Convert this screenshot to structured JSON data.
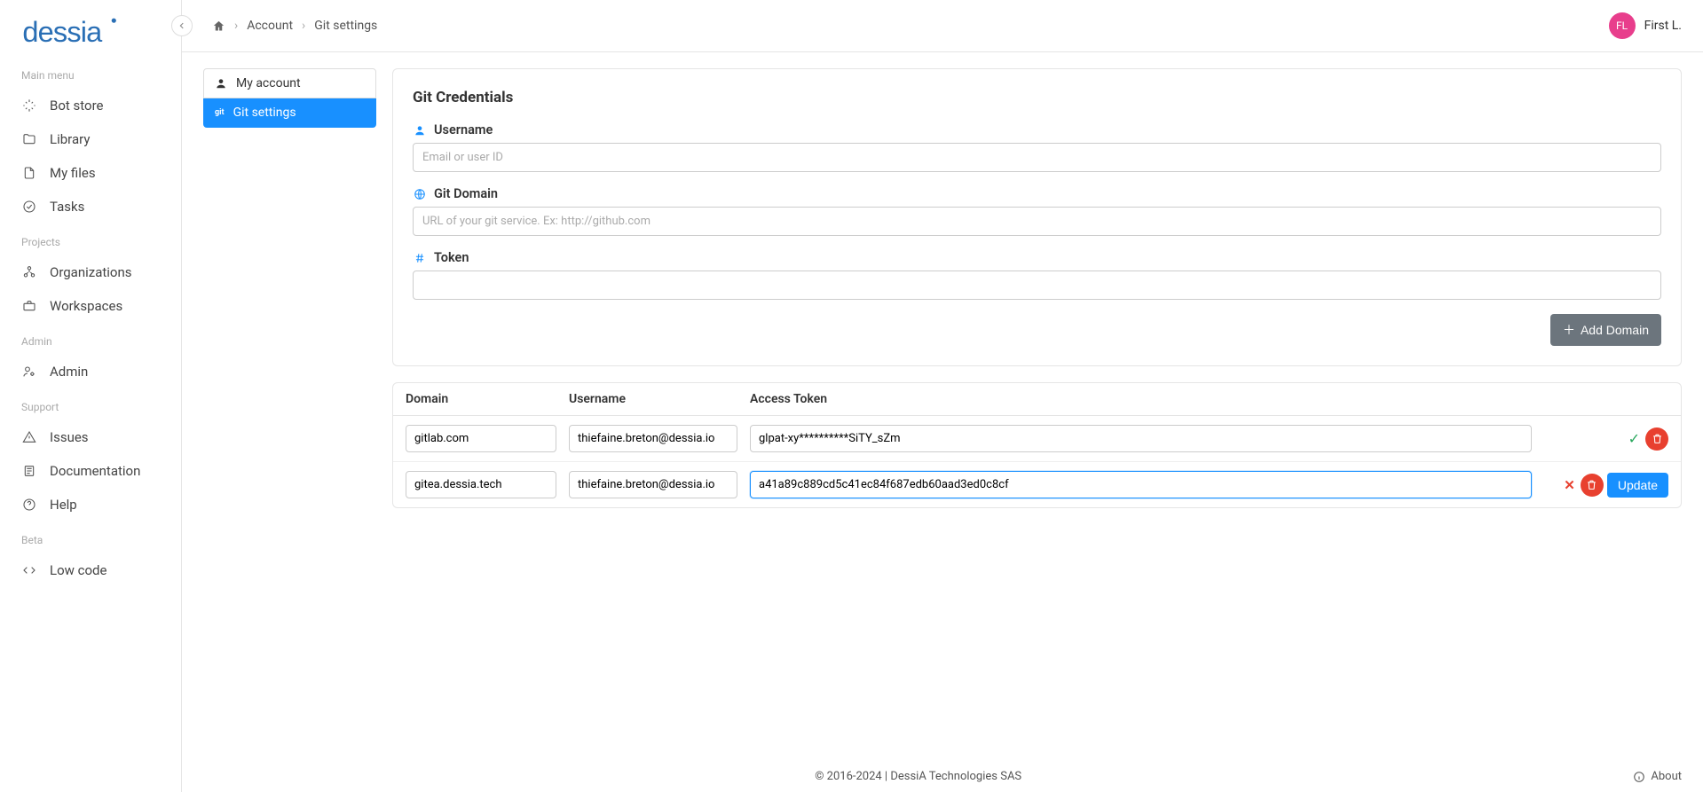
{
  "brand": "dessia",
  "breadcrumb": {
    "account": "Account",
    "git": "Git settings"
  },
  "user": {
    "initials": "FL",
    "name": "First L."
  },
  "sidebar": {
    "groups": [
      {
        "label": "Main menu",
        "items": [
          {
            "label": "Bot store"
          },
          {
            "label": "Library"
          },
          {
            "label": "My files"
          },
          {
            "label": "Tasks"
          }
        ]
      },
      {
        "label": "Projects",
        "items": [
          {
            "label": "Organizations"
          },
          {
            "label": "Workspaces"
          }
        ]
      },
      {
        "label": "Admin",
        "items": [
          {
            "label": "Admin"
          }
        ]
      },
      {
        "label": "Support",
        "items": [
          {
            "label": "Issues"
          },
          {
            "label": "Documentation"
          },
          {
            "label": "Help"
          }
        ]
      },
      {
        "label": "Beta",
        "items": [
          {
            "label": "Low code"
          }
        ]
      }
    ]
  },
  "subnav": {
    "my_account": "My account",
    "git_settings": "Git settings",
    "git_prefix": "git"
  },
  "form": {
    "title": "Git Credentials",
    "username_label": "Username",
    "username_ph": "Email or user ID",
    "domain_label": "Git Domain",
    "domain_ph": "URL of your git service. Ex: http://github.com",
    "token_label": "Token",
    "add_btn": "Add Domain"
  },
  "table": {
    "headers": {
      "domain": "Domain",
      "username": "Username",
      "token": "Access Token"
    },
    "rows": [
      {
        "domain": "gitlab.com",
        "username": "thiefaine.breton@dessia.io",
        "token": "glpat-xy**********SiTY_sZm",
        "state": "ok"
      },
      {
        "domain": "gitea.dessia.tech",
        "username": "thiefaine.breton@dessia.io",
        "token": "a41a89c889cd5c41ec84f687edb60aad3ed0c8cf",
        "state": "edit"
      }
    ],
    "update_btn": "Update"
  },
  "footer": {
    "copyright": "© 2016-2024 | DessiA Technologies SAS",
    "about": "About"
  }
}
